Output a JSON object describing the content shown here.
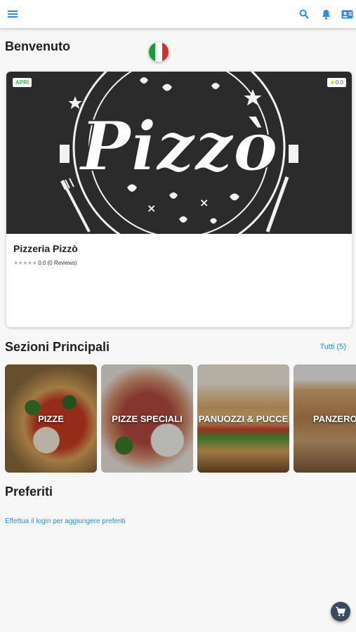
{
  "appbar": {
    "menu_icon": "hamburger-menu-icon",
    "search_icon": "search-icon",
    "notifications_icon": "bell-icon",
    "contact_icon": "contact-card-icon",
    "accent": "#2a8fd8"
  },
  "welcome": {
    "title": "Benvenuto",
    "flag": [
      "#1a9a3b",
      "#ffffff",
      "#d32f2f"
    ]
  },
  "restaurant": {
    "status_badge": "APRI",
    "rating_badge": "0.0",
    "logo_text": "Pizzò",
    "name": "Pizzeria Pizzò",
    "rating": "0.0",
    "reviews": "(0 Reviews)"
  },
  "sections": {
    "title": "Sezioni Principali",
    "see_all": "Tutti (5)",
    "items": [
      {
        "label": "PIZZE"
      },
      {
        "label": "PIZZE SPECIALI"
      },
      {
        "label": "PANUOZZI & PUCCE"
      },
      {
        "label": "PANZEROTTI"
      }
    ]
  },
  "favorites": {
    "title": "Preferiti",
    "login_prompt": "Effettua il login per aggiungere preferiti"
  },
  "cart": {
    "icon": "cart-icon"
  }
}
